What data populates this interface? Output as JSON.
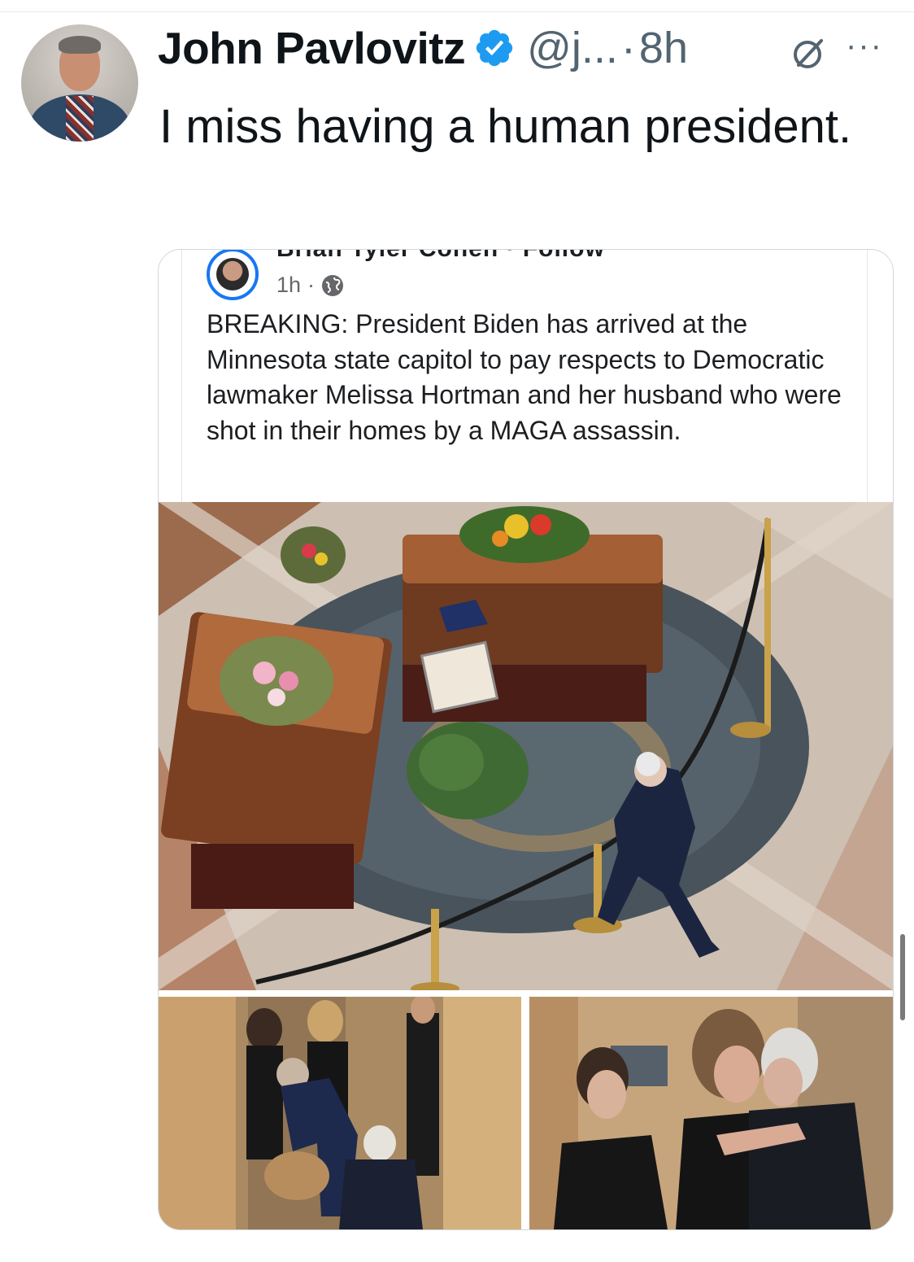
{
  "tweet": {
    "author_name": "John Pavlovitz",
    "handle": "@j...",
    "separator": "·",
    "time": "8h",
    "text": "I miss having a human president.",
    "icons": {
      "verified": "verified-badge-icon",
      "grok": "grok-icon",
      "more": "more-icon"
    },
    "colors": {
      "verified": "#1d9bf0",
      "secondary_text": "#536471"
    }
  },
  "embedded_post": {
    "author_cut_text": "Brian Tyler Cohen · Follow",
    "time": "1h",
    "separator": "·",
    "privacy_icon": "globe-icon",
    "text": "BREAKING: President Biden has arrived at the Minnesota state capitol to pay respects to Democratic lawmaker Melissa Hortman  and her husband who were shot in their homes by a MAGA assassin."
  },
  "photos": {
    "main": "rotunda-caskets-photo",
    "left": "hallway-photo",
    "right": "embrace-photo"
  }
}
